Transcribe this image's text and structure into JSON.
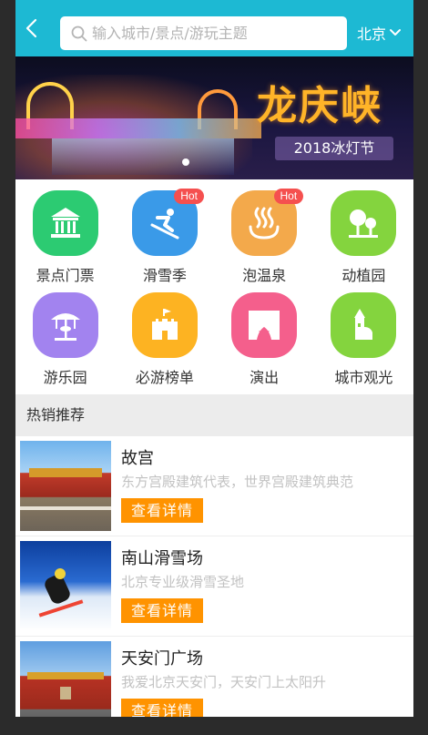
{
  "header": {
    "search_placeholder": "输入城市/景点/游玩主题",
    "city": "北京"
  },
  "banner": {
    "title": "龙庆峡",
    "subtitle": "2018冰灯节"
  },
  "categories": [
    {
      "label": "景点门票",
      "color": "#2ccb72",
      "icon": "pavilion-icon"
    },
    {
      "label": "滑雪季",
      "color": "#3a9ae8",
      "icon": "skier-icon",
      "badge": "Hot"
    },
    {
      "label": "泡温泉",
      "color": "#f3a94b",
      "icon": "hot-spring-icon",
      "badge": "Hot"
    },
    {
      "label": "动植园",
      "color": "#84d43e",
      "icon": "tree-icon"
    },
    {
      "label": "游乐园",
      "color": "#a283ef",
      "icon": "carousel-icon"
    },
    {
      "label": "必游榜单",
      "color": "#fdb322",
      "icon": "castle-icon"
    },
    {
      "label": "演出",
      "color": "#f45f8c",
      "icon": "stage-icon"
    },
    {
      "label": "城市观光",
      "color": "#84d43e",
      "icon": "tower-icon"
    }
  ],
  "hot": {
    "title": "热销推荐",
    "items": [
      {
        "name": "故宫",
        "desc": "东方宫殿建筑代表，世界宫殿建筑典范",
        "button": "查看详情"
      },
      {
        "name": "南山滑雪场",
        "desc": "北京专业级滑雪圣地",
        "button": "查看详情"
      },
      {
        "name": "天安门广场",
        "desc": "我爱北京天安门，天安门上太阳升",
        "button": "查看详情"
      }
    ]
  },
  "colors": {
    "header": "#1db9d3",
    "button": "#ff9300",
    "hot_badge": "#f5504f"
  }
}
